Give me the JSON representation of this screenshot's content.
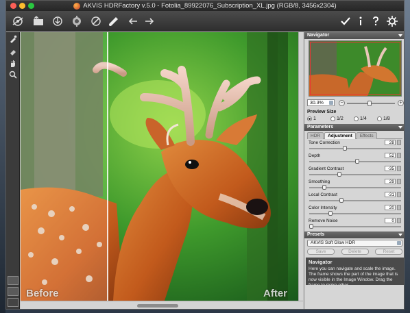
{
  "window": {
    "title": "AKVIS HDRFactory v.5.0 - Fotolia_89922076_Subscription_XL.jpg (RGB/8, 3456x2304)"
  },
  "toolbar": {
    "left_buttons": [
      {
        "name": "workspace-icon"
      },
      {
        "name": "open-image-icon"
      },
      {
        "name": "save-image-icon"
      },
      {
        "name": "batch-icon"
      },
      {
        "name": "plugins-icon"
      },
      {
        "name": "brush-icon"
      },
      {
        "name": "undo-arrow-icon"
      },
      {
        "name": "redo-arrow-icon"
      }
    ],
    "right_buttons": [
      {
        "name": "apply-check-icon"
      },
      {
        "name": "info-icon"
      },
      {
        "name": "help-icon"
      },
      {
        "name": "settings-gear-icon"
      }
    ]
  },
  "canvas": {
    "before_label": "Before",
    "after_label": "After"
  },
  "navigator": {
    "header": "Navigator",
    "zoom_value": "30.3%",
    "zoom_minus": "−",
    "zoom_plus": "+"
  },
  "preview_size": {
    "header": "Preview Size",
    "options": [
      "1",
      "1/2",
      "1/4",
      "1/8"
    ],
    "selected": "1"
  },
  "parameters": {
    "header": "Parameters",
    "tabs": [
      {
        "label": "HDR",
        "active": false
      },
      {
        "label": "Adjustment",
        "active": true
      },
      {
        "label": "Effects",
        "active": false
      }
    ],
    "sliders": [
      {
        "label": "Tone Correction",
        "value": "28",
        "fraction": 0.38
      },
      {
        "label": "Depth",
        "value": "52",
        "fraction": 0.52
      },
      {
        "label": "Gradient Contrast",
        "value": "-35",
        "fraction": 0.32
      },
      {
        "label": "Smoothing",
        "value": "29",
        "fraction": 0.15
      },
      {
        "label": "Local Contrast",
        "value": "-31",
        "fraction": 0.34
      },
      {
        "label": "Color Intensity",
        "value": "20",
        "fraction": 0.22
      },
      {
        "label": "Remove Noise",
        "value": "0",
        "fraction": 0.0
      }
    ]
  },
  "presets": {
    "header": "Presets",
    "selected": "AKVIS Soft Glow HDR",
    "buttons": [
      "Save",
      "Delete",
      "Reset"
    ]
  },
  "help": {
    "title": "Navigator",
    "text": "Here you can navigate and scale the image. The frame shows the part of the image that is now visible in the Image Window. Drag the frame to make other"
  },
  "colors": {
    "panel_bg": "#d6d6d6",
    "toolbar_bg": "#2f2f2f",
    "navigator_frame": "#ee3333"
  }
}
